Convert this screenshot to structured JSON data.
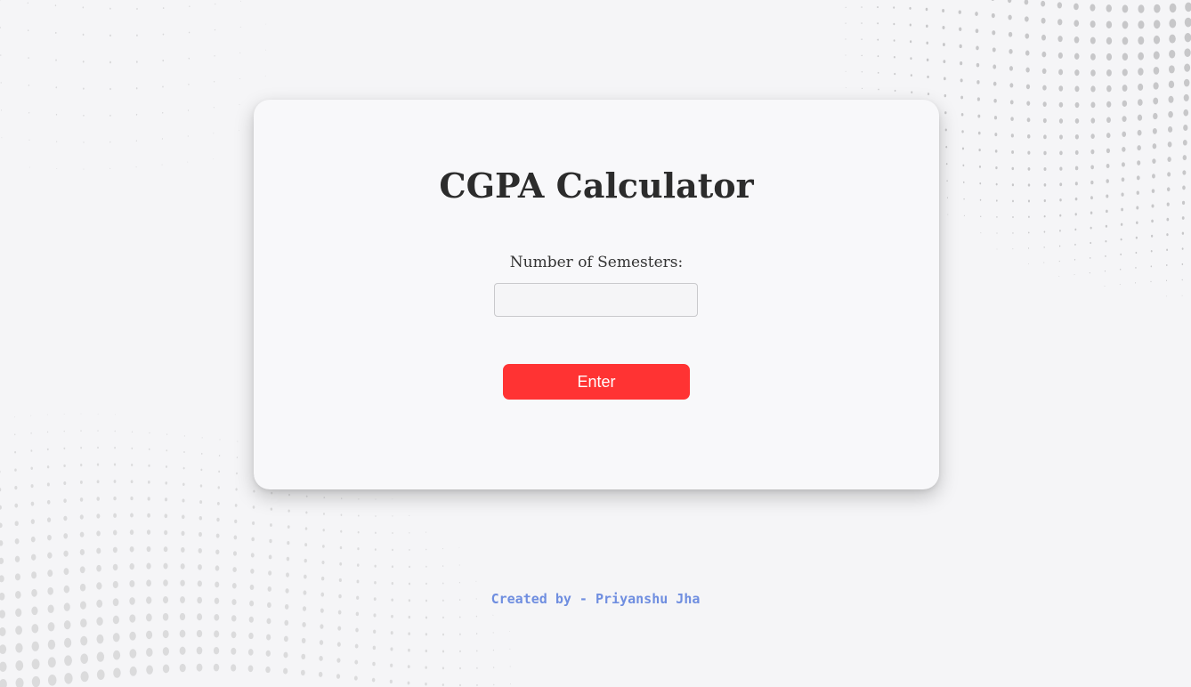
{
  "page": {
    "title": "CGPA Calculator",
    "semesters_label": "Number of Semesters:",
    "semesters_value": "",
    "enter_label": "Enter",
    "footer_text": "Created by - Priyanshu Jha"
  },
  "colors": {
    "background": "#f5f5f7",
    "card": "#f8f8fa",
    "button": "#ff3333",
    "footer_text": "#6f8ee0",
    "dots": "#c4c4c6"
  }
}
